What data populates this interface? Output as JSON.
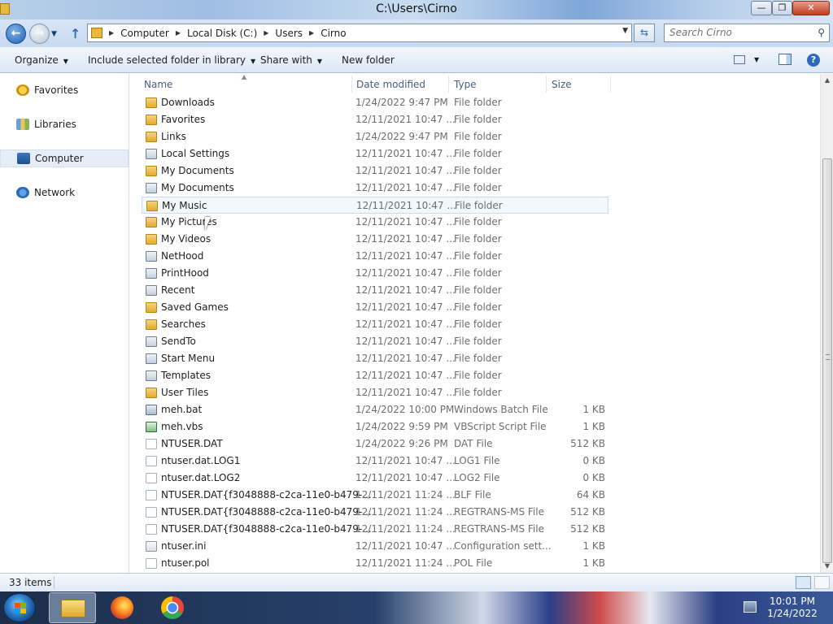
{
  "window": {
    "title": "C:\\Users\\Cirno",
    "min_glyph": "—",
    "max_glyph": "❐",
    "close_glyph": "✕"
  },
  "navbar": {
    "back_glyph": "←",
    "forward_glyph": "→",
    "recent_glyph": "▼",
    "up_glyph": "↑",
    "breadcrumb": [
      "Computer",
      "Local Disk (C:)",
      "Users",
      "Cirno"
    ],
    "crumb_separator": "▶",
    "dropdown_glyph": "▼",
    "refresh_glyph": "⇆",
    "search_placeholder": "Search Cirno",
    "search_glyph": "⚲"
  },
  "toolbar": {
    "organize": "Organize",
    "include_library": "Include selected folder in library",
    "share_with": "Share with",
    "new_folder": "New folder",
    "caret": "▼",
    "help": "?"
  },
  "navpane": {
    "items": [
      {
        "label": "Favorites",
        "icon": "star-icon"
      },
      {
        "label": "Libraries",
        "icon": "libraries-icon"
      },
      {
        "label": "Computer",
        "icon": "computer-icon"
      },
      {
        "label": "Network",
        "icon": "network-icon"
      }
    ]
  },
  "columns": {
    "name": "Name",
    "date": "Date modified",
    "type": "Type",
    "size": "Size",
    "sort_glyph": "▲"
  },
  "files": [
    {
      "name": "Downloads",
      "date": "1/24/2022 9:47 PM",
      "type": "File folder",
      "size": "",
      "icon": "folder"
    },
    {
      "name": "Favorites",
      "date": "12/11/2021 10:47 ...",
      "type": "File folder",
      "size": "",
      "icon": "folder"
    },
    {
      "name": "Links",
      "date": "1/24/2022 9:47 PM",
      "type": "File folder",
      "size": "",
      "icon": "folder"
    },
    {
      "name": "Local Settings",
      "date": "12/11/2021 10:47 ...",
      "type": "File folder",
      "size": "",
      "icon": "link"
    },
    {
      "name": "My Documents",
      "date": "12/11/2021 10:47 ...",
      "type": "File folder",
      "size": "",
      "icon": "folder"
    },
    {
      "name": "My Documents",
      "date": "12/11/2021 10:47 ...",
      "type": "File folder",
      "size": "",
      "icon": "link"
    },
    {
      "name": "My Music",
      "date": "12/11/2021 10:47 ...",
      "type": "File folder",
      "size": "",
      "icon": "folder"
    },
    {
      "name": "My Pictures",
      "date": "12/11/2021 10:47 ...",
      "type": "File folder",
      "size": "",
      "icon": "folder"
    },
    {
      "name": "My Videos",
      "date": "12/11/2021 10:47 ...",
      "type": "File folder",
      "size": "",
      "icon": "folder"
    },
    {
      "name": "NetHood",
      "date": "12/11/2021 10:47 ...",
      "type": "File folder",
      "size": "",
      "icon": "link"
    },
    {
      "name": "PrintHood",
      "date": "12/11/2021 10:47 ...",
      "type": "File folder",
      "size": "",
      "icon": "link"
    },
    {
      "name": "Recent",
      "date": "12/11/2021 10:47 ...",
      "type": "File folder",
      "size": "",
      "icon": "link"
    },
    {
      "name": "Saved Games",
      "date": "12/11/2021 10:47 ...",
      "type": "File folder",
      "size": "",
      "icon": "folder"
    },
    {
      "name": "Searches",
      "date": "12/11/2021 10:47 ...",
      "type": "File folder",
      "size": "",
      "icon": "folder"
    },
    {
      "name": "SendTo",
      "date": "12/11/2021 10:47 ...",
      "type": "File folder",
      "size": "",
      "icon": "link"
    },
    {
      "name": "Start Menu",
      "date": "12/11/2021 10:47 ...",
      "type": "File folder",
      "size": "",
      "icon": "link"
    },
    {
      "name": "Templates",
      "date": "12/11/2021 10:47 ...",
      "type": "File folder",
      "size": "",
      "icon": "link"
    },
    {
      "name": "User Tiles",
      "date": "12/11/2021 10:47 ...",
      "type": "File folder",
      "size": "",
      "icon": "folder"
    },
    {
      "name": "meh.bat",
      "date": "1/24/2022 10:00 PM",
      "type": "Windows Batch File",
      "size": "1 KB",
      "icon": "bat"
    },
    {
      "name": "meh.vbs",
      "date": "1/24/2022 9:59 PM",
      "type": "VBScript Script File",
      "size": "1 KB",
      "icon": "vbs"
    },
    {
      "name": "NTUSER.DAT",
      "date": "1/24/2022 9:26 PM",
      "type": "DAT File",
      "size": "512 KB",
      "icon": "file"
    },
    {
      "name": "ntuser.dat.LOG1",
      "date": "12/11/2021 10:47 ...",
      "type": "LOG1 File",
      "size": "0 KB",
      "icon": "file"
    },
    {
      "name": "ntuser.dat.LOG2",
      "date": "12/11/2021 10:47 ...",
      "type": "LOG2 File",
      "size": "0 KB",
      "icon": "file"
    },
    {
      "name": "NTUSER.DAT{f3048888-c2ca-11e0-b479-...",
      "date": "12/11/2021 11:24 ...",
      "type": "BLF File",
      "size": "64 KB",
      "icon": "file"
    },
    {
      "name": "NTUSER.DAT{f3048888-c2ca-11e0-b479-...",
      "date": "12/11/2021 11:24 ...",
      "type": "REGTRANS-MS File",
      "size": "512 KB",
      "icon": "file"
    },
    {
      "name": "NTUSER.DAT{f3048888-c2ca-11e0-b479-...",
      "date": "12/11/2021 11:24 ...",
      "type": "REGTRANS-MS File",
      "size": "512 KB",
      "icon": "file"
    },
    {
      "name": "ntuser.ini",
      "date": "12/11/2021 10:47 ...",
      "type": "Configuration sett...",
      "size": "1 KB",
      "icon": "ini"
    },
    {
      "name": "ntuser.pol",
      "date": "12/11/2021 11:24 ...",
      "type": "POL File",
      "size": "1 KB",
      "icon": "file"
    }
  ],
  "hovered_file_index": 6,
  "scrollbar": {
    "up_glyph": "▲",
    "down_glyph": "▼"
  },
  "status": {
    "item_count": "33 items"
  },
  "taskbar": {
    "apps": [
      "windows-explorer",
      "firefox",
      "chrome"
    ],
    "clock_time": "10:01 PM",
    "clock_date": "1/24/2022"
  }
}
